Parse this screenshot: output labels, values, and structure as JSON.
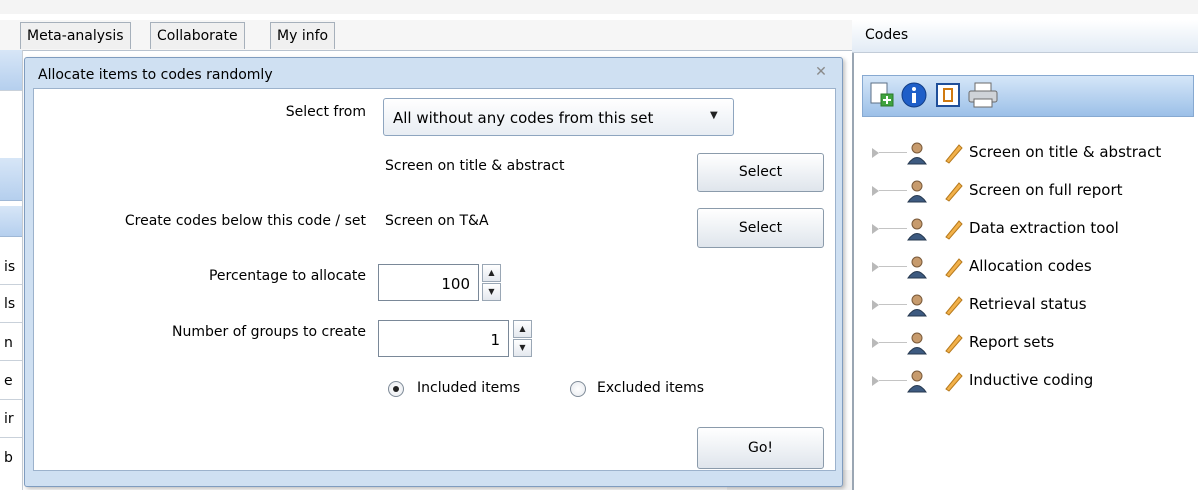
{
  "tabs": [
    "Meta-analysis",
    "Collaborate",
    "My info"
  ],
  "left_fragments": [
    "is",
    "ls",
    "n",
    "e",
    "ir",
    "b"
  ],
  "codes_panel": {
    "title": "Codes",
    "toolbar_icons": [
      "add-code-icon",
      "info-icon",
      "properties-icon",
      "print-icon"
    ],
    "items": [
      "Screen on title & abstract",
      "Screen on full report",
      "Data extraction tool",
      "Allocation codes",
      "Retrieval status",
      "Report sets",
      "Inductive coding"
    ]
  },
  "dialog": {
    "title": "Allocate items to codes randomly",
    "close_glyph": "✕",
    "select_from_label": "Select from",
    "select_from_value": "All without any codes from this set",
    "selected_set": "Screen on title & abstract",
    "select_button_1": "Select",
    "create_below_label": "Create codes below this code / set",
    "create_below_value": "Screen on T&A",
    "select_button_2": "Select",
    "percentage_label": "Percentage to allocate",
    "percentage_value": "100",
    "groups_label": "Number of groups to create",
    "groups_value": "1",
    "radio_included": "Included items",
    "radio_excluded": "Excluded items",
    "selected_radio": "Included items",
    "go_button": "Go!"
  }
}
